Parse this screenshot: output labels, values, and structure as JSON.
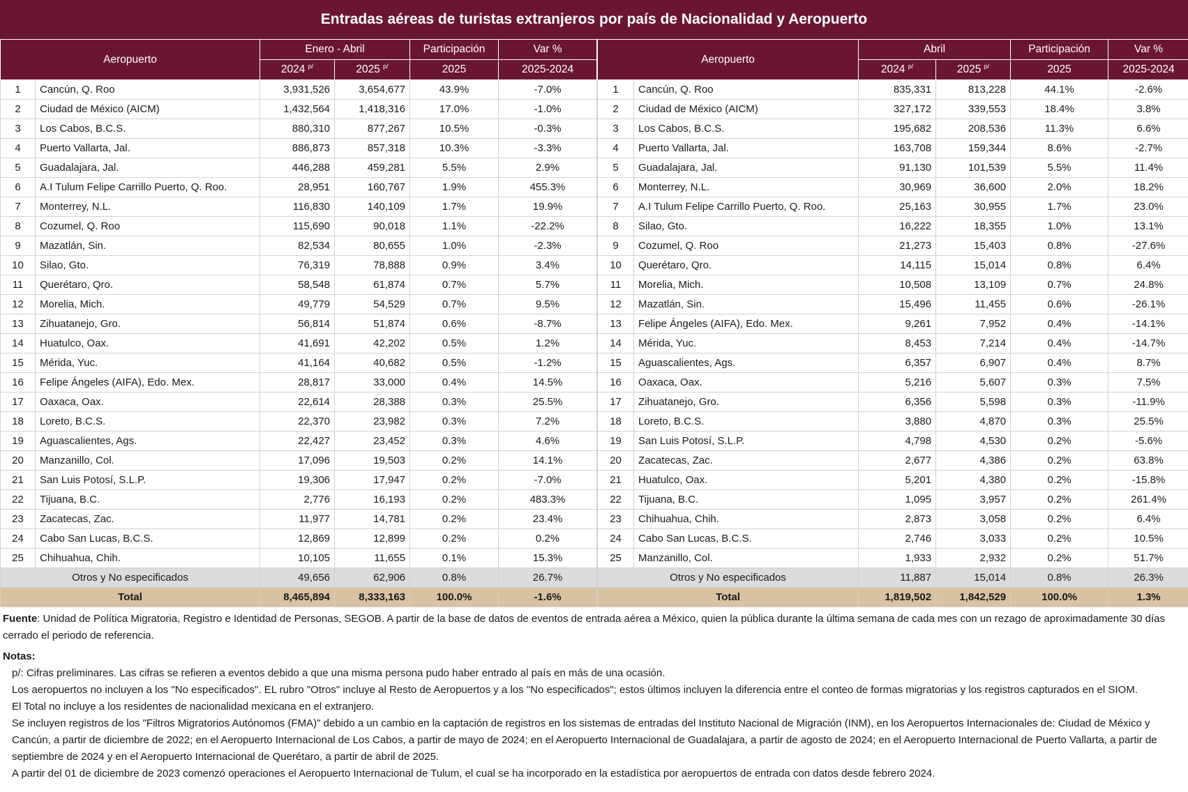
{
  "title": "Entradas aéreas de turistas extranjeros por país de Nacionalidad y Aeropuerto",
  "headers": {
    "airport": "Aeropuerto",
    "left_period": "Enero - Abril",
    "right_period": "Abril",
    "year_2024": "2024",
    "year_2025": "2025",
    "prelim_mark": "p/",
    "share": "Participación",
    "share_year": "2025",
    "var": "Var %",
    "var_range": "2025-2024"
  },
  "left_rows": [
    {
      "rank": "1",
      "name": "Cancún, Q. Roo",
      "v2024": "3,931,526",
      "v2025": "3,654,677",
      "share": "43.9%",
      "var": "-7.0%"
    },
    {
      "rank": "2",
      "name": "Ciudad de México (AICM)",
      "v2024": "1,432,564",
      "v2025": "1,418,316",
      "share": "17.0%",
      "var": "-1.0%"
    },
    {
      "rank": "3",
      "name": "Los Cabos, B.C.S.",
      "v2024": "880,310",
      "v2025": "877,267",
      "share": "10.5%",
      "var": "-0.3%"
    },
    {
      "rank": "4",
      "name": "Puerto Vallarta, Jal.",
      "v2024": "886,873",
      "v2025": "857,318",
      "share": "10.3%",
      "var": "-3.3%"
    },
    {
      "rank": "5",
      "name": "Guadalajara, Jal.",
      "v2024": "446,288",
      "v2025": "459,281",
      "share": "5.5%",
      "var": "2.9%"
    },
    {
      "rank": "6",
      "name": "A.I Tulum Felipe Carrillo Puerto, Q. Roo.",
      "v2024": "28,951",
      "v2025": "160,767",
      "share": "1.9%",
      "var": "455.3%"
    },
    {
      "rank": "7",
      "name": "Monterrey, N.L.",
      "v2024": "116,830",
      "v2025": "140,109",
      "share": "1.7%",
      "var": "19.9%"
    },
    {
      "rank": "8",
      "name": "Cozumel, Q. Roo",
      "v2024": "115,690",
      "v2025": "90,018",
      "share": "1.1%",
      "var": "-22.2%"
    },
    {
      "rank": "9",
      "name": "Mazatlán, Sin.",
      "v2024": "82,534",
      "v2025": "80,655",
      "share": "1.0%",
      "var": "-2.3%"
    },
    {
      "rank": "10",
      "name": "Silao, Gto.",
      "v2024": "76,319",
      "v2025": "78,888",
      "share": "0.9%",
      "var": "3.4%"
    },
    {
      "rank": "11",
      "name": "Querétaro, Qro.",
      "v2024": "58,548",
      "v2025": "61,874",
      "share": "0.7%",
      "var": "5.7%"
    },
    {
      "rank": "12",
      "name": "Morelia, Mich.",
      "v2024": "49,779",
      "v2025": "54,529",
      "share": "0.7%",
      "var": "9.5%"
    },
    {
      "rank": "13",
      "name": "Zihuatanejo, Gro.",
      "v2024": "56,814",
      "v2025": "51,874",
      "share": "0.6%",
      "var": "-8.7%"
    },
    {
      "rank": "14",
      "name": "Huatulco, Oax.",
      "v2024": "41,691",
      "v2025": "42,202",
      "share": "0.5%",
      "var": "1.2%"
    },
    {
      "rank": "15",
      "name": "Mérida, Yuc.",
      "v2024": "41,164",
      "v2025": "40,682",
      "share": "0.5%",
      "var": "-1.2%"
    },
    {
      "rank": "16",
      "name": "Felipe Ángeles (AIFA), Edo. Mex.",
      "v2024": "28,817",
      "v2025": "33,000",
      "share": "0.4%",
      "var": "14.5%"
    },
    {
      "rank": "17",
      "name": "Oaxaca, Oax.",
      "v2024": "22,614",
      "v2025": "28,388",
      "share": "0.3%",
      "var": "25.5%"
    },
    {
      "rank": "18",
      "name": "Loreto, B.C.S.",
      "v2024": "22,370",
      "v2025": "23,982",
      "share": "0.3%",
      "var": "7.2%"
    },
    {
      "rank": "19",
      "name": "Aguascalientes, Ags.",
      "v2024": "22,427",
      "v2025": "23,452",
      "share": "0.3%",
      "var": "4.6%"
    },
    {
      "rank": "20",
      "name": "Manzanillo, Col.",
      "v2024": "17,096",
      "v2025": "19,503",
      "share": "0.2%",
      "var": "14.1%"
    },
    {
      "rank": "21",
      "name": "San Luis Potosí, S.L.P.",
      "v2024": "19,306",
      "v2025": "17,947",
      "share": "0.2%",
      "var": "-7.0%"
    },
    {
      "rank": "22",
      "name": "Tijuana, B.C.",
      "v2024": "2,776",
      "v2025": "16,193",
      "share": "0.2%",
      "var": "483.3%"
    },
    {
      "rank": "23",
      "name": "Zacatecas, Zac.",
      "v2024": "11,977",
      "v2025": "14,781",
      "share": "0.2%",
      "var": "23.4%"
    },
    {
      "rank": "24",
      "name": "Cabo San Lucas, B.C.S.",
      "v2024": "12,869",
      "v2025": "12,899",
      "share": "0.2%",
      "var": "0.2%"
    },
    {
      "rank": "25",
      "name": "Chihuahua, Chih.",
      "v2024": "10,105",
      "v2025": "11,655",
      "share": "0.1%",
      "var": "15.3%"
    }
  ],
  "left_otros": {
    "label": "Otros y No especificados",
    "v2024": "49,656",
    "v2025": "62,906",
    "share": "0.8%",
    "var": "26.7%"
  },
  "left_total": {
    "label": "Total",
    "v2024": "8,465,894",
    "v2025": "8,333,163",
    "share": "100.0%",
    "var": "-1.6%"
  },
  "right_rows": [
    {
      "rank": "1",
      "name": "Cancún, Q. Roo",
      "v2024": "835,331",
      "v2025": "813,228",
      "share": "44.1%",
      "var": "-2.6%"
    },
    {
      "rank": "2",
      "name": "Ciudad de México (AICM)",
      "v2024": "327,172",
      "v2025": "339,553",
      "share": "18.4%",
      "var": "3.8%"
    },
    {
      "rank": "3",
      "name": "Los Cabos, B.C.S.",
      "v2024": "195,682",
      "v2025": "208,536",
      "share": "11.3%",
      "var": "6.6%"
    },
    {
      "rank": "4",
      "name": "Puerto Vallarta, Jal.",
      "v2024": "163,708",
      "v2025": "159,344",
      "share": "8.6%",
      "var": "-2.7%"
    },
    {
      "rank": "5",
      "name": "Guadalajara, Jal.",
      "v2024": "91,130",
      "v2025": "101,539",
      "share": "5.5%",
      "var": "11.4%"
    },
    {
      "rank": "6",
      "name": "Monterrey, N.L.",
      "v2024": "30,969",
      "v2025": "36,600",
      "share": "2.0%",
      "var": "18.2%"
    },
    {
      "rank": "7",
      "name": "A.I Tulum Felipe Carrillo Puerto, Q. Roo.",
      "v2024": "25,163",
      "v2025": "30,955",
      "share": "1.7%",
      "var": "23.0%"
    },
    {
      "rank": "8",
      "name": "Silao, Gto.",
      "v2024": "16,222",
      "v2025": "18,355",
      "share": "1.0%",
      "var": "13.1%"
    },
    {
      "rank": "9",
      "name": "Cozumel, Q. Roo",
      "v2024": "21,273",
      "v2025": "15,403",
      "share": "0.8%",
      "var": "-27.6%"
    },
    {
      "rank": "10",
      "name": "Querétaro, Qro.",
      "v2024": "14,115",
      "v2025": "15,014",
      "share": "0.8%",
      "var": "6.4%"
    },
    {
      "rank": "11",
      "name": "Morelia, Mich.",
      "v2024": "10,508",
      "v2025": "13,109",
      "share": "0.7%",
      "var": "24.8%"
    },
    {
      "rank": "12",
      "name": "Mazatlán, Sin.",
      "v2024": "15,496",
      "v2025": "11,455",
      "share": "0.6%",
      "var": "-26.1%"
    },
    {
      "rank": "13",
      "name": "Felipe Ángeles (AIFA), Edo. Mex.",
      "v2024": "9,261",
      "v2025": "7,952",
      "share": "0.4%",
      "var": "-14.1%"
    },
    {
      "rank": "14",
      "name": "Mérida, Yuc.",
      "v2024": "8,453",
      "v2025": "7,214",
      "share": "0.4%",
      "var": "-14.7%"
    },
    {
      "rank": "15",
      "name": "Aguascalientes, Ags.",
      "v2024": "6,357",
      "v2025": "6,907",
      "share": "0.4%",
      "var": "8.7%"
    },
    {
      "rank": "16",
      "name": "Oaxaca, Oax.",
      "v2024": "5,216",
      "v2025": "5,607",
      "share": "0.3%",
      "var": "7.5%"
    },
    {
      "rank": "17",
      "name": "Zihuatanejo, Gro.",
      "v2024": "6,356",
      "v2025": "5,598",
      "share": "0.3%",
      "var": "-11.9%"
    },
    {
      "rank": "18",
      "name": "Loreto, B.C.S.",
      "v2024": "3,880",
      "v2025": "4,870",
      "share": "0.3%",
      "var": "25.5%"
    },
    {
      "rank": "19",
      "name": "San Luis Potosí, S.L.P.",
      "v2024": "4,798",
      "v2025": "4,530",
      "share": "0.2%",
      "var": "-5.6%"
    },
    {
      "rank": "20",
      "name": "Zacatecas, Zac.",
      "v2024": "2,677",
      "v2025": "4,386",
      "share": "0.2%",
      "var": "63.8%"
    },
    {
      "rank": "21",
      "name": "Huatulco, Oax.",
      "v2024": "5,201",
      "v2025": "4,380",
      "share": "0.2%",
      "var": "-15.8%"
    },
    {
      "rank": "22",
      "name": "Tijuana, B.C.",
      "v2024": "1,095",
      "v2025": "3,957",
      "share": "0.2%",
      "var": "261.4%"
    },
    {
      "rank": "23",
      "name": "Chihuahua, Chih.",
      "v2024": "2,873",
      "v2025": "3,058",
      "share": "0.2%",
      "var": "6.4%"
    },
    {
      "rank": "24",
      "name": "Cabo San Lucas, B.C.S.",
      "v2024": "2,746",
      "v2025": "3,033",
      "share": "0.2%",
      "var": "10.5%"
    },
    {
      "rank": "25",
      "name": "Manzanillo, Col.",
      "v2024": "1,933",
      "v2025": "2,932",
      "share": "0.2%",
      "var": "51.7%"
    }
  ],
  "right_otros": {
    "label": "Otros y No especificados",
    "v2024": "11,887",
    "v2025": "15,014",
    "share": "0.8%",
    "var": "26.3%"
  },
  "right_total": {
    "label": "Total",
    "v2024": "1,819,502",
    "v2025": "1,842,529",
    "share": "100.0%",
    "var": "1.3%"
  },
  "notes": {
    "source_label": "Fuente",
    "source_text": ": Unidad de Política Migratoria, Registro e Identidad de Personas, SEGOB. A partir de la base de datos de eventos de entrada aérea a México, quien la pública durante la última semana de cada mes con un rezago de aproximadamente 30 días cerrado el periodo de referencia.",
    "notes_label": "Notas:",
    "lines": [
      "p/: Cifras preliminares.   Las cifras se refieren a eventos debido a que una misma persona pudo haber entrado al país en más de una ocasión.",
      "Los aeropuertos no incluyen a los \"No especificados\".   EL rubro \"Otros\" incluye al Resto de Aeropuertos y a los \"No especificados\";  estos últimos incluyen la diferencia entre el conteo de formas migratorias y los registros capturados en el SIOM.",
      "El Total no incluye a los residentes de nacionalidad mexicana en el extranjero.",
      "Se incluyen registros de los \"Filtros Migratorios Autónomos (FMA)\" debido a un cambio en la captación de registros en los sistemas de entradas del Instituto Nacional de Migración (INM), en los Aeropuertos Internacionales de: Ciudad de México y Cancún, a partir de diciembre de 2022; en el Aeropuerto Internacional de Los Cabos, a partir de mayo de 2024; en el Aeropuerto Internacional de Guadalajara, a partir de agosto de 2024; en el Aeropuerto Internacional de Puerto Vallarta, a partir de septiembre de 2024 y en el Aeropuerto Internacional de Querétaro, a partir de abril de 2025.",
      "A partir del 01 de diciembre de 2023 comenzó operaciones el Aeropuerto Internacional de Tulum, el cual se ha incorporado en la estadística por aeropuertos de entrada con datos desde febrero 2024."
    ]
  }
}
